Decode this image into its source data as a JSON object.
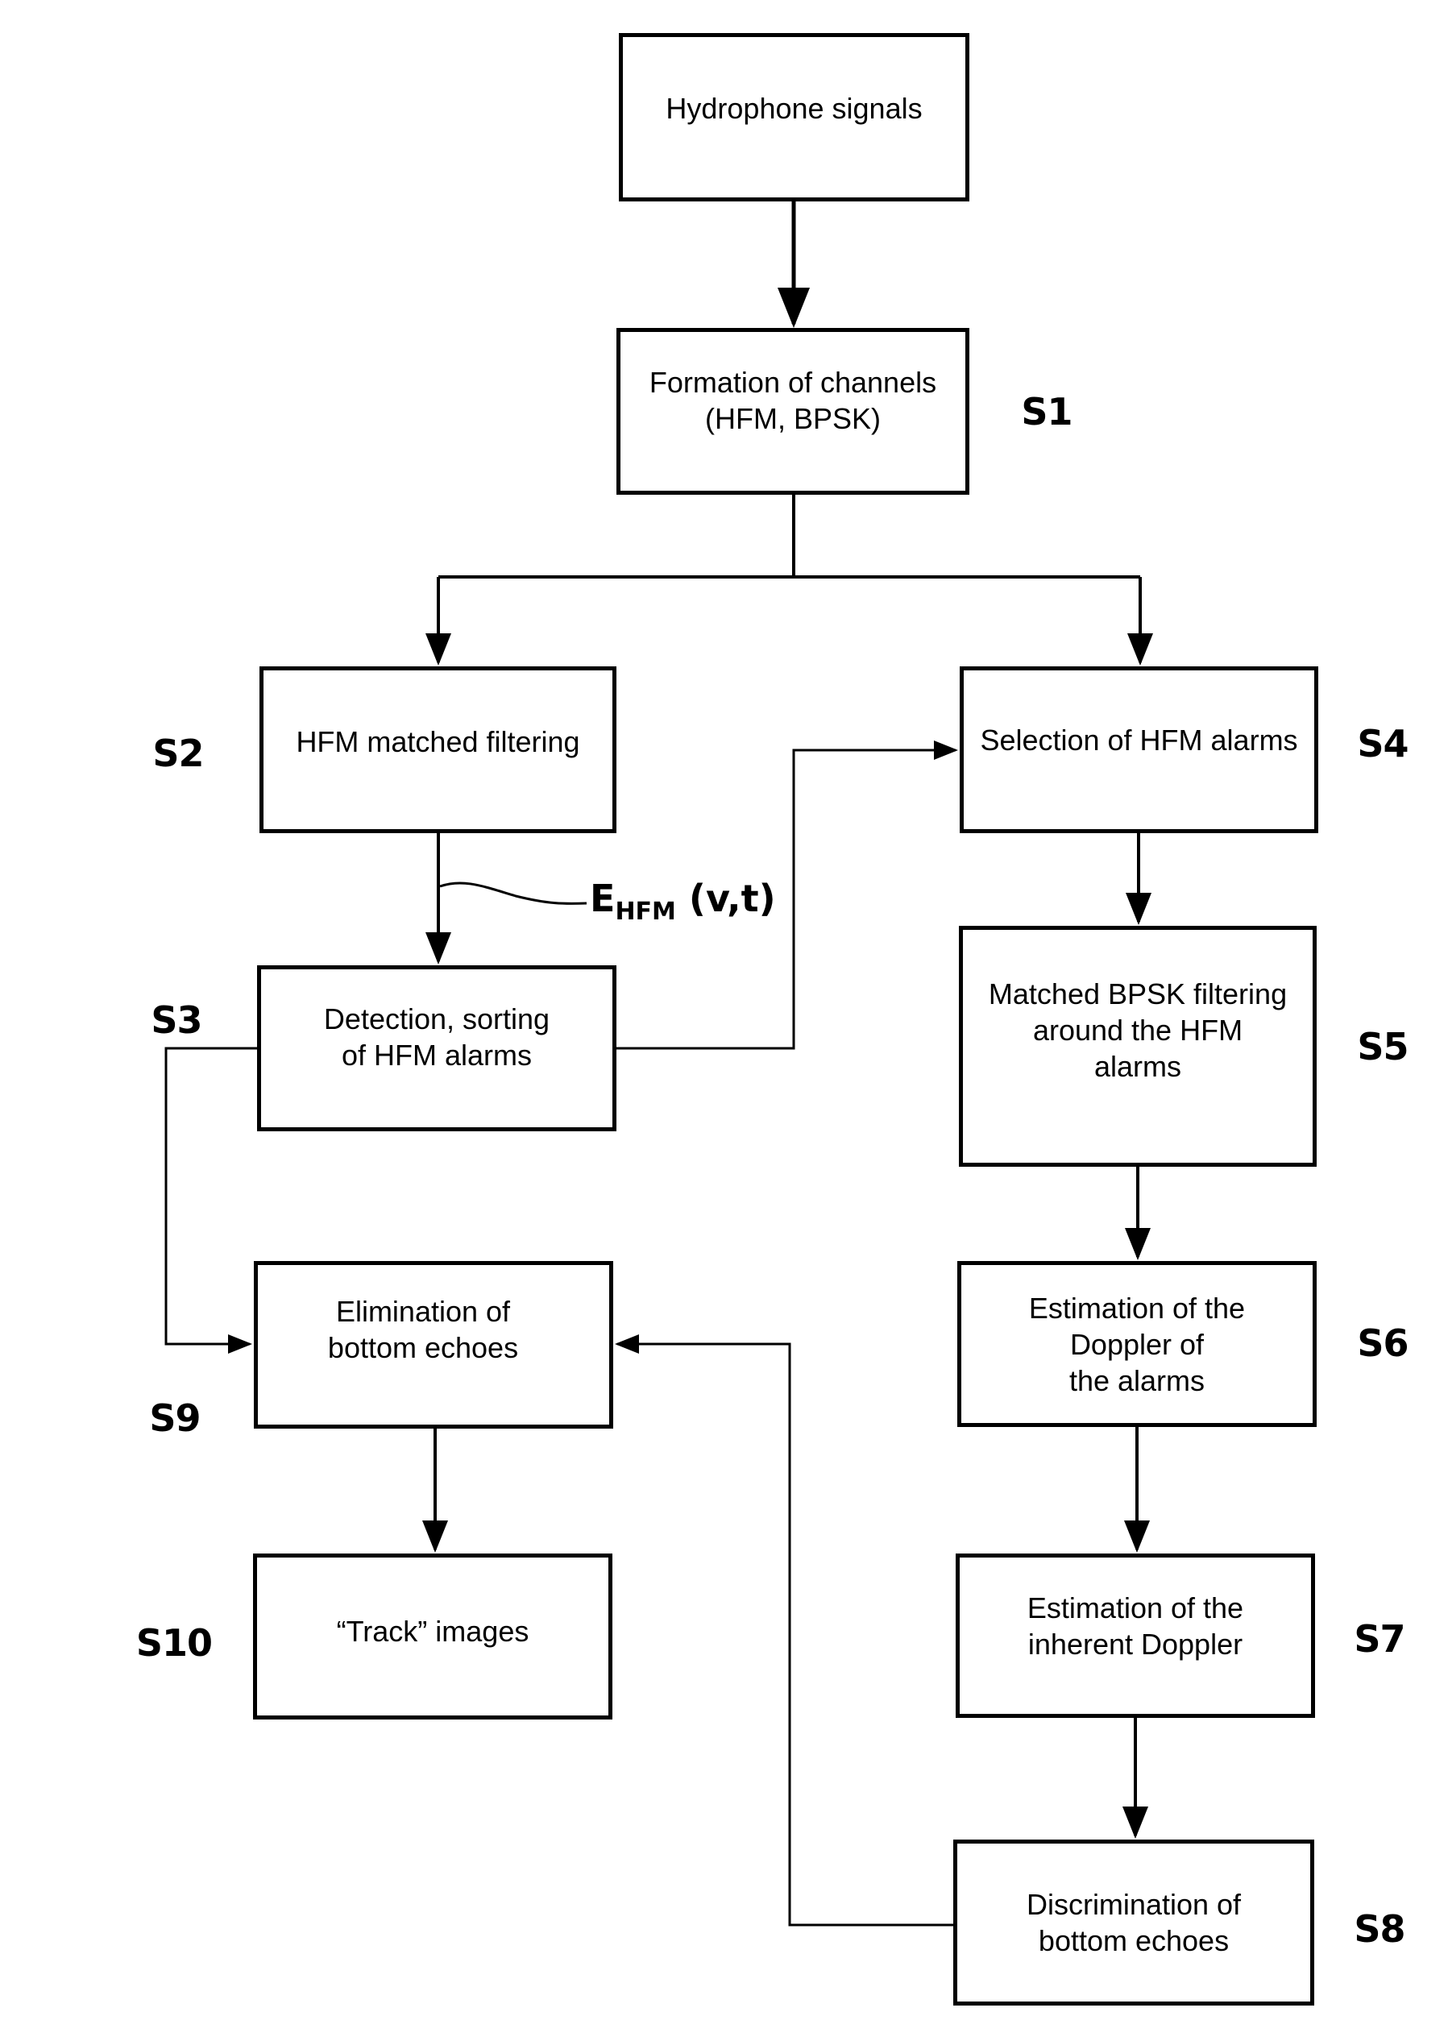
{
  "diagram": {
    "type": "flowchart",
    "nodes": [
      {
        "id": "hydrophone",
        "label": "Hydrophone signals",
        "step": ""
      },
      {
        "id": "s1",
        "label": "Formation of channels\n(HFM, BPSK)",
        "step": "S1"
      },
      {
        "id": "s2",
        "label": "HFM matched filtering",
        "step": "S2"
      },
      {
        "id": "s3",
        "label": "Detection, sorting\nof HFM alarms",
        "step": "S3"
      },
      {
        "id": "s4",
        "label": "Selection of HFM alarms",
        "step": "S4"
      },
      {
        "id": "s5",
        "label": "Matched BPSK filtering\naround the HFM\nalarms",
        "step": "S5"
      },
      {
        "id": "s6",
        "label": "Estimation of the\nDoppler of\nthe alarms",
        "step": "S6"
      },
      {
        "id": "s7",
        "label": "Estimation of the\ninherent Doppler",
        "step": "S7"
      },
      {
        "id": "s8",
        "label": "Discrimination of\nbottom echoes",
        "step": "S8"
      },
      {
        "id": "s9",
        "label": "Elimination of\nbottom echoes",
        "step": "S9"
      },
      {
        "id": "s10",
        "label": "“Track” images",
        "step": "S10"
      }
    ],
    "edges": [
      {
        "from": "hydrophone",
        "to": "s1"
      },
      {
        "from": "s1",
        "to": "s2"
      },
      {
        "from": "s1",
        "to": "s4"
      },
      {
        "from": "s2",
        "to": "s3",
        "label": "E_HFM(v,t)"
      },
      {
        "from": "s3",
        "to": "s4"
      },
      {
        "from": "s3",
        "to": "s9"
      },
      {
        "from": "s4",
        "to": "s5"
      },
      {
        "from": "s5",
        "to": "s6"
      },
      {
        "from": "s6",
        "to": "s7"
      },
      {
        "from": "s7",
        "to": "s8"
      },
      {
        "from": "s8",
        "to": "s9"
      },
      {
        "from": "s9",
        "to": "s10"
      }
    ],
    "signal_label": {
      "main": "E",
      "sub": "HFM",
      "args": " (v,t)"
    }
  }
}
